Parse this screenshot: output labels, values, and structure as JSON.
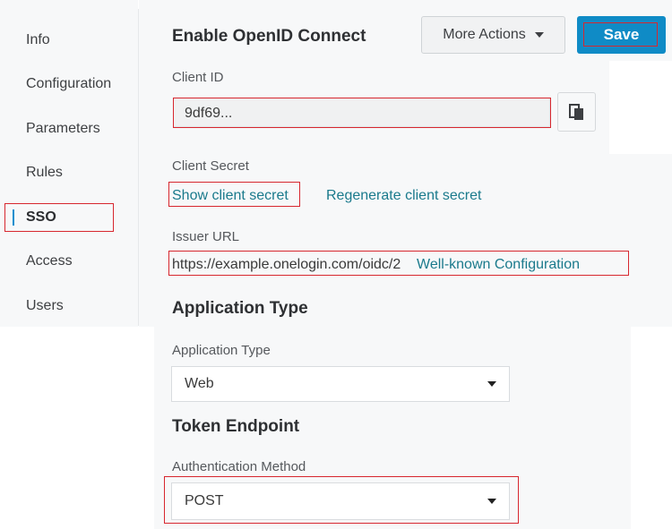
{
  "sidebar": {
    "items": [
      {
        "label": "Info",
        "active": false
      },
      {
        "label": "Configuration",
        "active": false
      },
      {
        "label": "Parameters",
        "active": false
      },
      {
        "label": "Rules",
        "active": false
      },
      {
        "label": "SSO",
        "active": true
      },
      {
        "label": "Access",
        "active": false
      },
      {
        "label": "Users",
        "active": false
      }
    ]
  },
  "header": {
    "title": "Enable OpenID Connect",
    "more_actions_label": "More Actions",
    "save_label": "Save"
  },
  "client_id": {
    "label": "Client ID",
    "value": "9df69...",
    "copy_icon": "copy-icon"
  },
  "client_secret": {
    "label": "Client Secret",
    "show_link": "Show client secret",
    "regenerate_link": "Regenerate client secret"
  },
  "issuer": {
    "label": "Issuer URL",
    "url": "https://example.onelogin.com/oidc/2",
    "wellknown_link": "Well-known Configuration"
  },
  "application_type": {
    "section_title": "Application Type",
    "label": "Application Type",
    "selected": "Web"
  },
  "token_endpoint": {
    "section_title": "Token Endpoint",
    "label": "Authentication Method",
    "selected": "POST"
  },
  "colors": {
    "accent": "#0f8bc6",
    "link": "#1a7a8c",
    "highlight_box": "#d7272f"
  }
}
